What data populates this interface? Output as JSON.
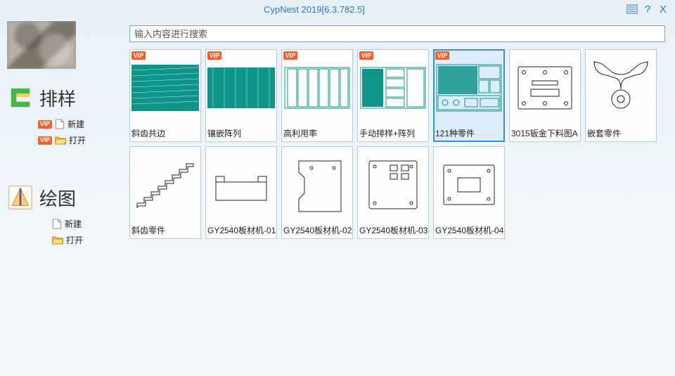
{
  "window": {
    "title": "CypNest 2019[6.3.782.5]"
  },
  "sidebar": {
    "nest": {
      "title": "排样",
      "actions": [
        {
          "label": "新建",
          "vip": "VIP",
          "icon": "file-new"
        },
        {
          "label": "打开",
          "vip": "VIP",
          "icon": "folder-open"
        }
      ]
    },
    "draw": {
      "title": "绘图",
      "actions": [
        {
          "label": "新建",
          "icon": "file-new"
        },
        {
          "label": "打开",
          "icon": "folder-open"
        }
      ]
    }
  },
  "search": {
    "placeholder": "输入内容进行搜索"
  },
  "vip_text": "VIP",
  "tiles": [
    {
      "label": "斜齿共边",
      "vip": true,
      "style": "teal-dense"
    },
    {
      "label": "镶嵌阵列",
      "vip": true,
      "style": "teal-dense2"
    },
    {
      "label": "高利用率",
      "vip": true,
      "style": "teal-panels"
    },
    {
      "label": "手动排样+阵列",
      "vip": true,
      "style": "teal-mixed"
    },
    {
      "label": "121种零件",
      "vip": true,
      "style": "teal-scatter",
      "selected": true
    },
    {
      "label": "3015钣金下料图A",
      "vip": false,
      "style": "line-plate"
    },
    {
      "label": "嵌套零件",
      "vip": false,
      "style": "line-yoke"
    },
    {
      "label": "斜齿零件",
      "vip": false,
      "style": "line-stairs"
    },
    {
      "label": "GY2540板材机-01",
      "vip": false,
      "style": "line-gy01"
    },
    {
      "label": "GY2540板材机-02",
      "vip": false,
      "style": "line-gy02"
    },
    {
      "label": "GY2540板材机-03",
      "vip": false,
      "style": "line-gy03"
    },
    {
      "label": "GY2540板材机-04",
      "vip": false,
      "style": "line-gy04"
    }
  ]
}
